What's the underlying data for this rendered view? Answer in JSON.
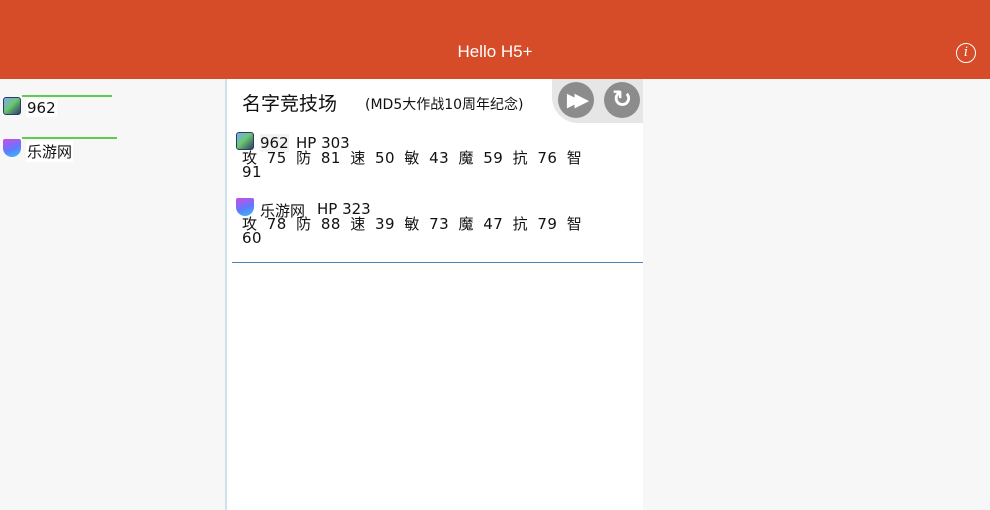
{
  "header": {
    "title": "Hello H5+",
    "info_icon": "info-icon"
  },
  "roster": [
    {
      "name": "962",
      "avatar": "avatar-a",
      "hp_fraction": 1.0
    },
    {
      "name": "乐游网",
      "avatar": "avatar-b",
      "hp_fraction": 1.0
    }
  ],
  "arena": {
    "title": "名字竞技场",
    "subtitle": "(MD5大作战10周年纪念)",
    "fast_forward_icon": "fast-forward-icon",
    "restart_icon": "restart-icon",
    "fighters": [
      {
        "name": "962",
        "hp_text": "HP  303",
        "stats_line1": "攻 75 防 81 速 50 敏 43 魔 59 抗 76 智",
        "stats_line2": "91"
      },
      {
        "name": "乐游网",
        "hp_text": "HP  323",
        "stats_line1": "攻 78 防 88 速 39 敏 73 魔 47 抗 79 智",
        "stats_line2": "60"
      }
    ]
  },
  "colors": {
    "header": "#d64b28",
    "hp_bar": "#5ecb53",
    "divider": "#4a86b5"
  }
}
